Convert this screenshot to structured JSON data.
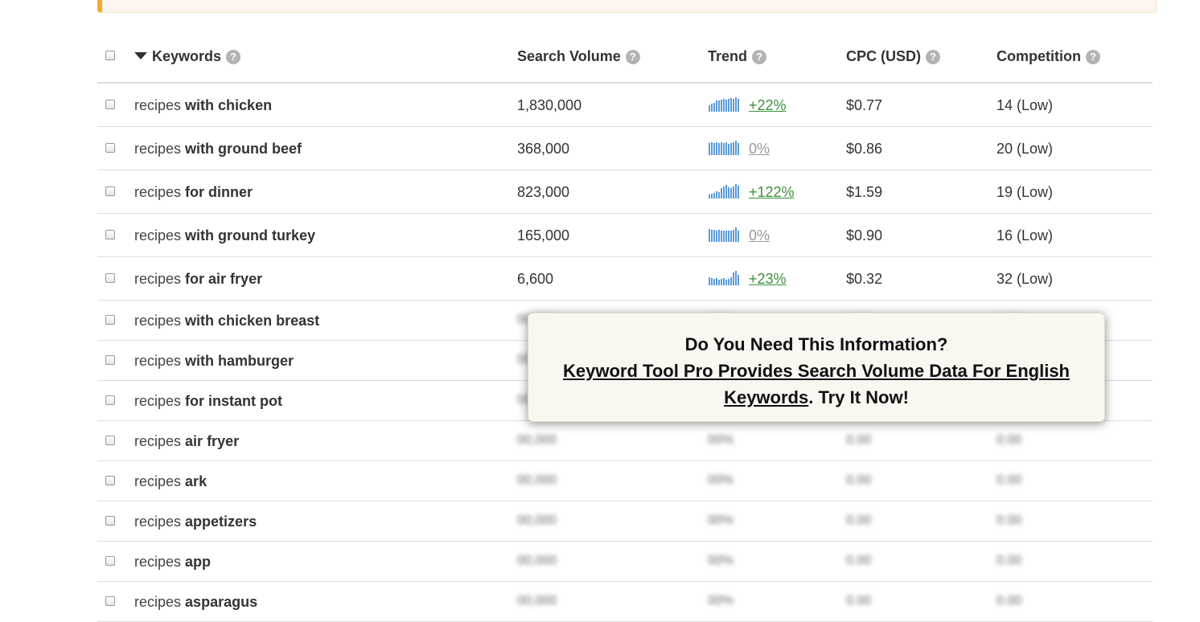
{
  "header": {
    "keywords": "Keywords",
    "search_volume": "Search Volume",
    "trend": "Trend",
    "cpc": "CPC (USD)",
    "competition": "Competition"
  },
  "help_glyph": "?",
  "rows": [
    {
      "base": "recipes",
      "mod": "with chicken",
      "volume": "1,830,000",
      "trend": "+22%",
      "trend_dir": "up",
      "spark": [
        0.45,
        0.55,
        0.6,
        0.75,
        0.8,
        0.85,
        0.9,
        0.85,
        0.9,
        0.95,
        0.9,
        1.0,
        0.9
      ],
      "cpc": "$0.77",
      "competition": "14 (Low)"
    },
    {
      "base": "recipes",
      "mod": "with ground beef",
      "volume": "368,000",
      "trend": "0%",
      "trend_dir": "flat",
      "spark": [
        0.85,
        0.9,
        0.85,
        0.9,
        0.85,
        0.9,
        0.85,
        0.9,
        0.8,
        0.85,
        0.9,
        1.0,
        0.85
      ],
      "cpc": "$0.86",
      "competition": "20 (Low)"
    },
    {
      "base": "recipes",
      "mod": "for dinner",
      "volume": "823,000",
      "trend": "+122%",
      "trend_dir": "up",
      "spark": [
        0.3,
        0.35,
        0.4,
        0.5,
        0.45,
        0.7,
        0.85,
        0.95,
        0.8,
        0.7,
        0.85,
        1.0,
        0.9
      ],
      "cpc": "$1.59",
      "competition": "19 (Low)"
    },
    {
      "base": "recipes",
      "mod": "with ground turkey",
      "volume": "165,000",
      "trend": "0%",
      "trend_dir": "flat",
      "spark": [
        0.9,
        0.85,
        0.85,
        0.8,
        0.85,
        0.8,
        0.75,
        0.8,
        0.75,
        0.8,
        0.85,
        1.0,
        0.8
      ],
      "cpc": "$0.90",
      "competition": "16 (Low)"
    },
    {
      "base": "recipes",
      "mod": "for air fryer",
      "volume": "6,600",
      "trend": "+23%",
      "trend_dir": "up",
      "spark": [
        0.55,
        0.5,
        0.45,
        0.5,
        0.4,
        0.45,
        0.5,
        0.4,
        0.45,
        0.55,
        0.9,
        1.0,
        0.7
      ],
      "cpc": "$0.32",
      "competition": "32 (Low)"
    },
    {
      "base": "recipes",
      "mod": "with chicken breast",
      "hidden": true
    },
    {
      "base": "recipes",
      "mod": "with hamburger",
      "hidden": true
    },
    {
      "base": "recipes",
      "mod": "for instant pot",
      "hidden": true
    },
    {
      "base": "recipes",
      "mod": "air fryer",
      "hidden": true
    },
    {
      "base": "recipes",
      "mod": "ark",
      "hidden": true
    },
    {
      "base": "recipes",
      "mod": "appetizers",
      "hidden": true
    },
    {
      "base": "recipes",
      "mod": "app",
      "hidden": true
    },
    {
      "base": "recipes",
      "mod": "asparagus",
      "hidden": true
    }
  ],
  "placeholder": {
    "volume": "00,000",
    "trend": "00%",
    "cpc": "0.00",
    "competition": "0.00"
  },
  "popup": {
    "title": "Do You Need This Information?",
    "link": "Keyword Tool Pro Provides Search Volume Data For English Keywords",
    "cta": ". Try It Now!"
  },
  "colors": {
    "accent": "#f0ad2e",
    "trend_up": "#3c8f3c",
    "spark": "#5b9bd8"
  }
}
